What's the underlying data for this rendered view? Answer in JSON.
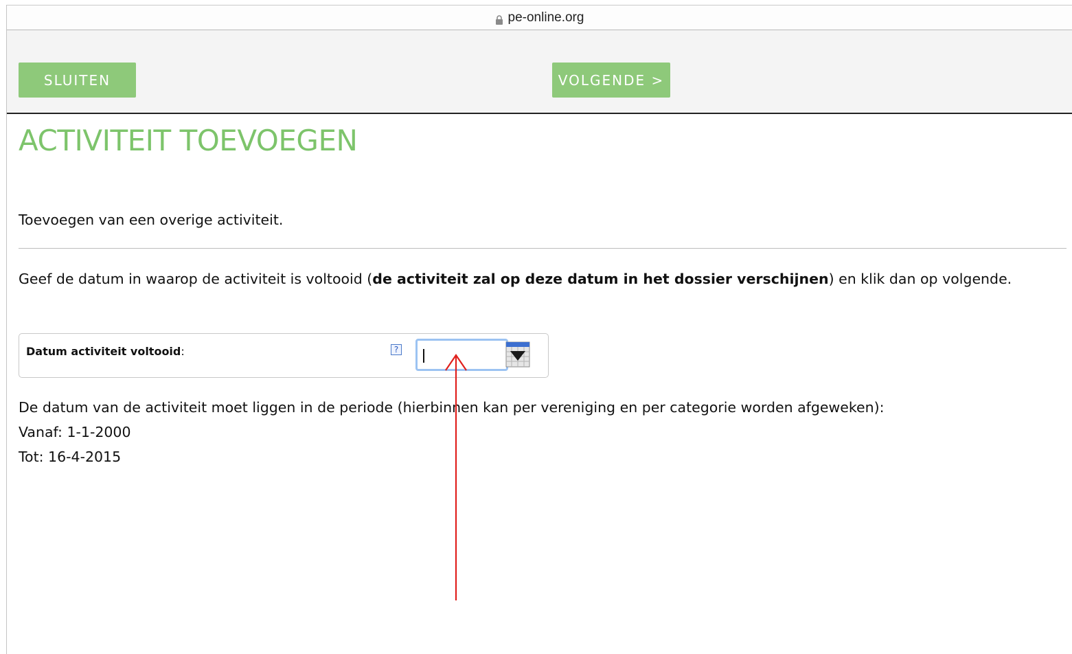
{
  "browser": {
    "url": "pe-online.org"
  },
  "toolbar": {
    "close_label": "SLUITEN",
    "next_label": "VOLGENDE >"
  },
  "page": {
    "title": "ACTIVITEIT TOEVOEGEN",
    "intro": "Toevoegen van een overige activiteit.",
    "instruction_before": "Geef de datum in waarop de activiteit is voltooid (",
    "instruction_bold": "de activiteit zal op deze datum in het dossier verschijnen",
    "instruction_after": ") en klik dan op volgende."
  },
  "form": {
    "date_label": "Datum activiteit voltooid",
    "date_label_suffix": ":",
    "help_glyph": "?",
    "date_value": ""
  },
  "period": {
    "description": "De datum van de activiteit moet liggen in de periode (hierbinnen kan per vereniging en per categorie worden afgeweken):",
    "from": "Vanaf: 1-1-2000",
    "to": "Tot: 16-4-2015"
  },
  "colors": {
    "accent_green": "#7dc46b",
    "button_green": "#8ec97a",
    "annotation_red": "#e0201c",
    "input_focus": "#9cc3f2"
  },
  "icons": {
    "lock": "lock-icon",
    "help": "help-icon",
    "calendar": "calendar-icon",
    "annotation": "red-arrow-annotation"
  }
}
